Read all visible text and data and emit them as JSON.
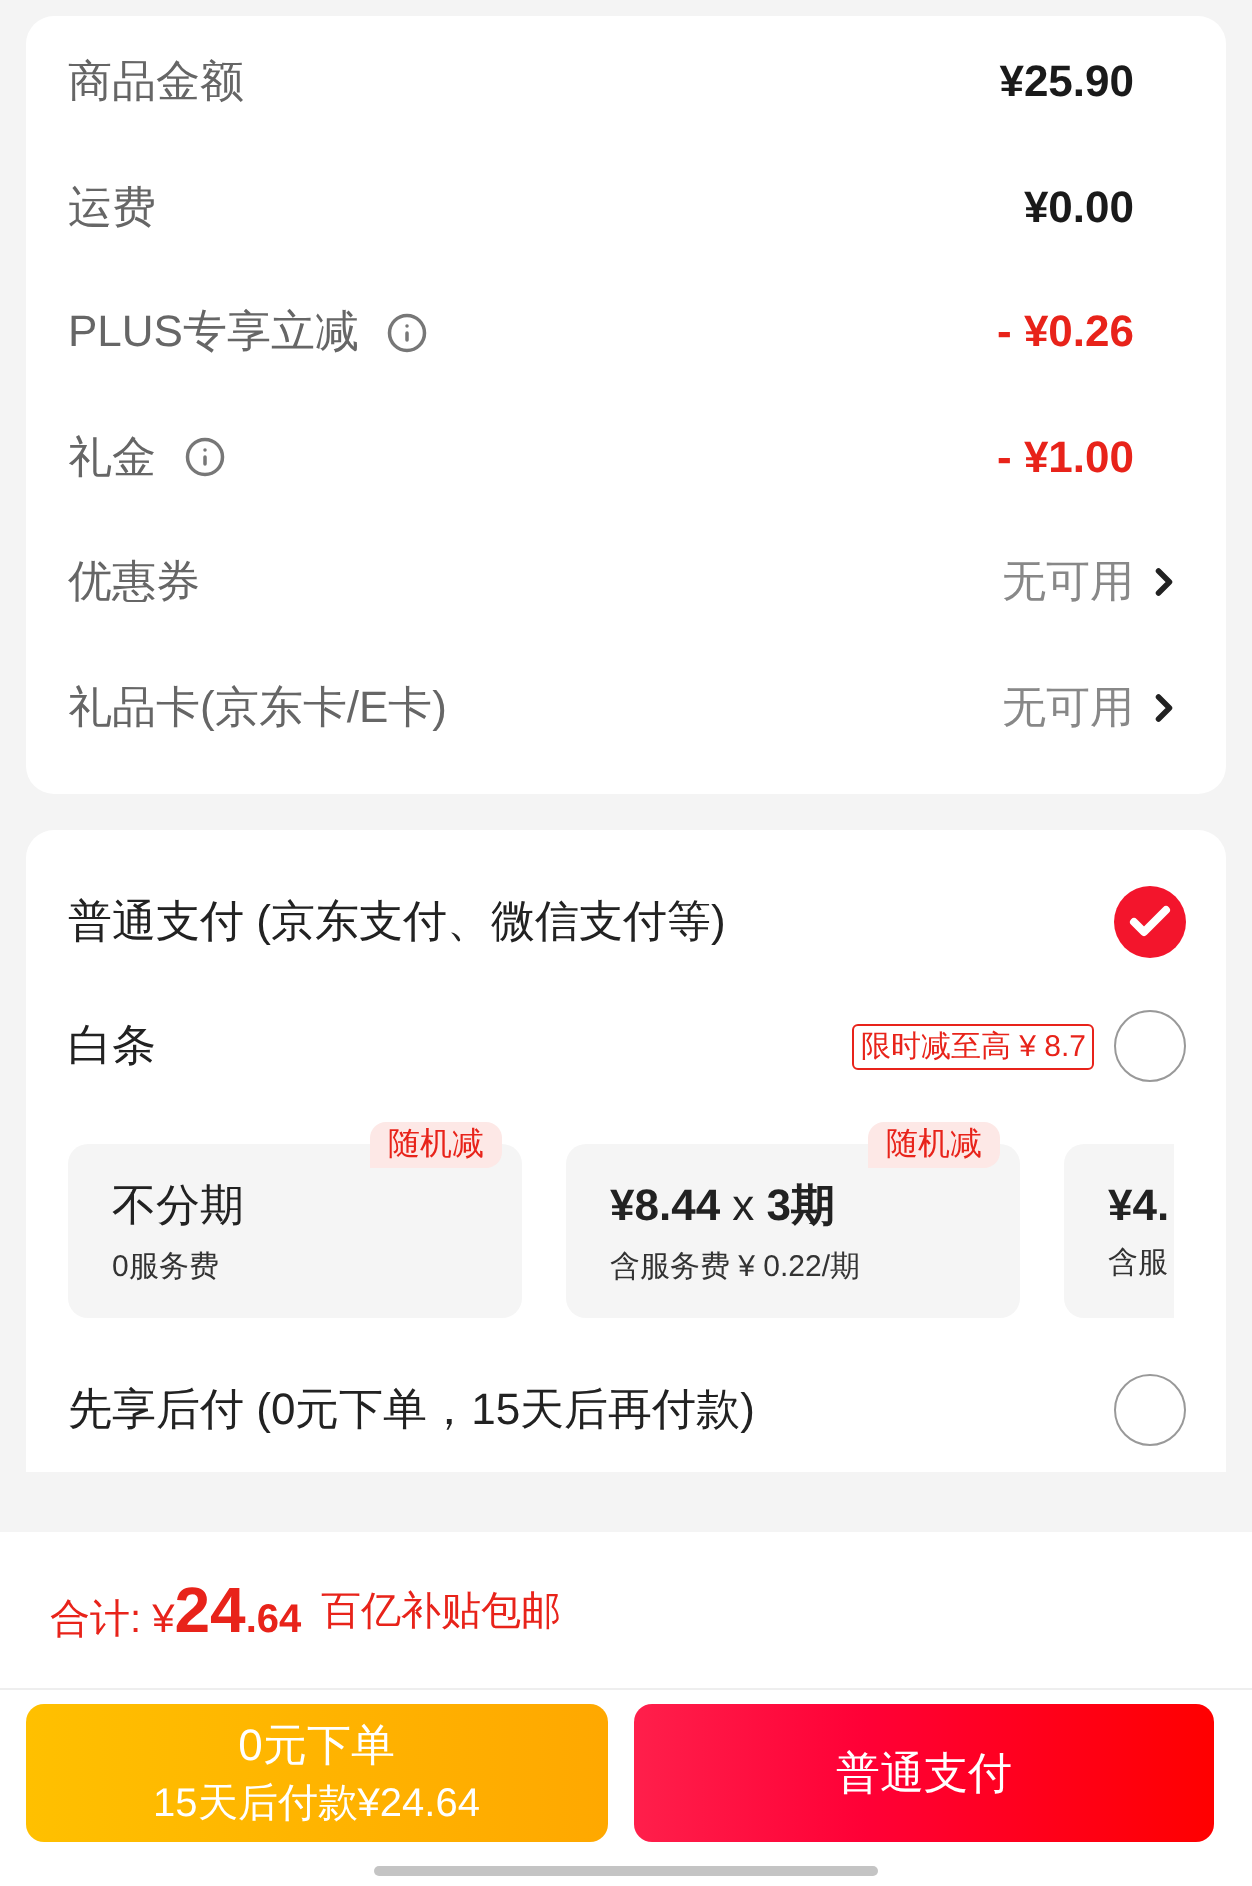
{
  "price_rows": [
    {
      "label": "商品金额",
      "value": "¥25.90",
      "kind": "amount",
      "info": false
    },
    {
      "label": "运费",
      "value": "¥0.00",
      "kind": "amount",
      "info": false
    },
    {
      "label": "PLUS专享立减",
      "value": "- ¥0.26",
      "kind": "discount",
      "info": true
    },
    {
      "label": "礼金",
      "value": "- ¥1.00",
      "kind": "discount",
      "info": true
    },
    {
      "label": "优惠券",
      "value": "无可用",
      "kind": "link",
      "info": false
    },
    {
      "label": "礼品卡(京东卡/E卡)",
      "value": "无可用",
      "kind": "link",
      "info": false
    }
  ],
  "payment_options": [
    {
      "label": "普通支付 (京东支付、微信支付等)",
      "selected": true
    },
    {
      "label": "白条",
      "selected": false,
      "badge": "限时减至高 ¥ 8.7",
      "plans": [
        {
          "title": "不分期",
          "note": "0服务费",
          "tag": "随机减"
        },
        {
          "title": "**¥8.44** x **3期**",
          "note": "含服务费 ¥ 0.22/期",
          "tag": "随机减"
        },
        {
          "title": "**¥4.**",
          "note": "含服"
        }
      ]
    },
    {
      "label": "先享后付 (0元下单，15天后再付款)",
      "selected": false
    }
  ],
  "total": {
    "label": "合计:",
    "currency": "¥",
    "integer": "24",
    "decimal": ".64",
    "note": "百亿补贴包邮"
  },
  "buttons": [
    {
      "kind": "later",
      "title": "0元下单",
      "subtitle": "15天后付款¥24.64"
    },
    {
      "kind": "pay",
      "title": "普通支付"
    }
  ]
}
